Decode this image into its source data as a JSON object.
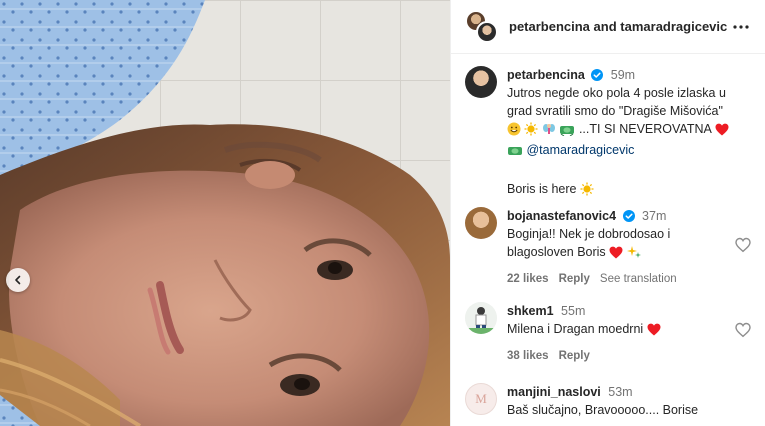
{
  "header": {
    "user1": "petarbencina",
    "and_text": "and",
    "user2": "tamaradragicevic",
    "more_icon": "more-horizontal-icon"
  },
  "caption": {
    "username": "petarbencina",
    "time": "59m",
    "text_line1": "Jutros negde oko pola 4 posle izlaska u",
    "text_line2": "grad svratili smo do \"Dragiše Mišovića\"",
    "text_line3": "...TI SI NEVEROVATNA",
    "mention": "@tamaradragicevic",
    "text_boris": "Boris is here"
  },
  "comments": [
    {
      "username": "bojanastefanovic4",
      "time": "37m",
      "verified": true,
      "text_line1": "Boginja!! Nek je dobrodosao i",
      "text_line2": "blagosloven Boris",
      "likes": "22 likes",
      "reply": "Reply",
      "translate": "See translation"
    },
    {
      "username": "shkem1",
      "time": "55m",
      "verified": false,
      "text_line1": "Milena i Dragan moedrni",
      "likes": "38 likes",
      "reply": "Reply"
    },
    {
      "username": "manjini_naslovi",
      "time": "53m",
      "verified": false,
      "text_line1": "Baš slučajno, Bravooooo.... Borise"
    }
  ],
  "colors": {
    "link": "#00376b",
    "muted": "#737373",
    "verified": "#0095f6",
    "heart": "#ed1c24"
  }
}
